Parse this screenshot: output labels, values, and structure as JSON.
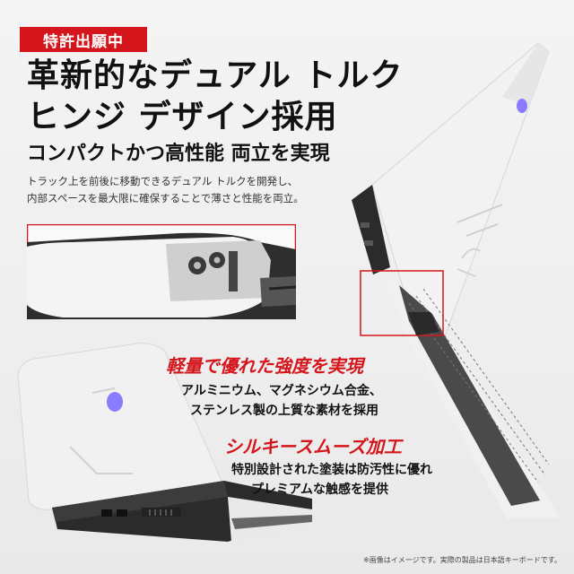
{
  "badge": {
    "label": "特許出願中"
  },
  "headline": {
    "line1": "革新的なデュアル トルク",
    "line2": "ヒンジ デザイン採用"
  },
  "subhead": "コンパクトかつ高性能 両立を実現",
  "description": {
    "line1": "トラック上を前後に移動できるデュアル トルクを開発し、",
    "line2": "内部スペースを最大限に確保することで薄さと性能を両立。"
  },
  "features": [
    {
      "title": "軽量で優れた強度を実現",
      "line1": "アルミニウム、マグネシウム合金、",
      "line2": "ステンレス製の上質な素材を採用"
    },
    {
      "title": "シルキースムーズ加工",
      "line1": "特別設計された塗装は防汚性に優れ",
      "line2": "プレミアムな触感を提供"
    }
  ],
  "footnote": "※画像はイメージです。実際の製品は日本語キーボードです。",
  "colors": {
    "accent": "#d4151b",
    "logo": "#8b7cff",
    "chassis": "#f2f2f2",
    "dark": "#2a2a2a"
  },
  "icons": {
    "logo": "alien-logo-icon"
  }
}
